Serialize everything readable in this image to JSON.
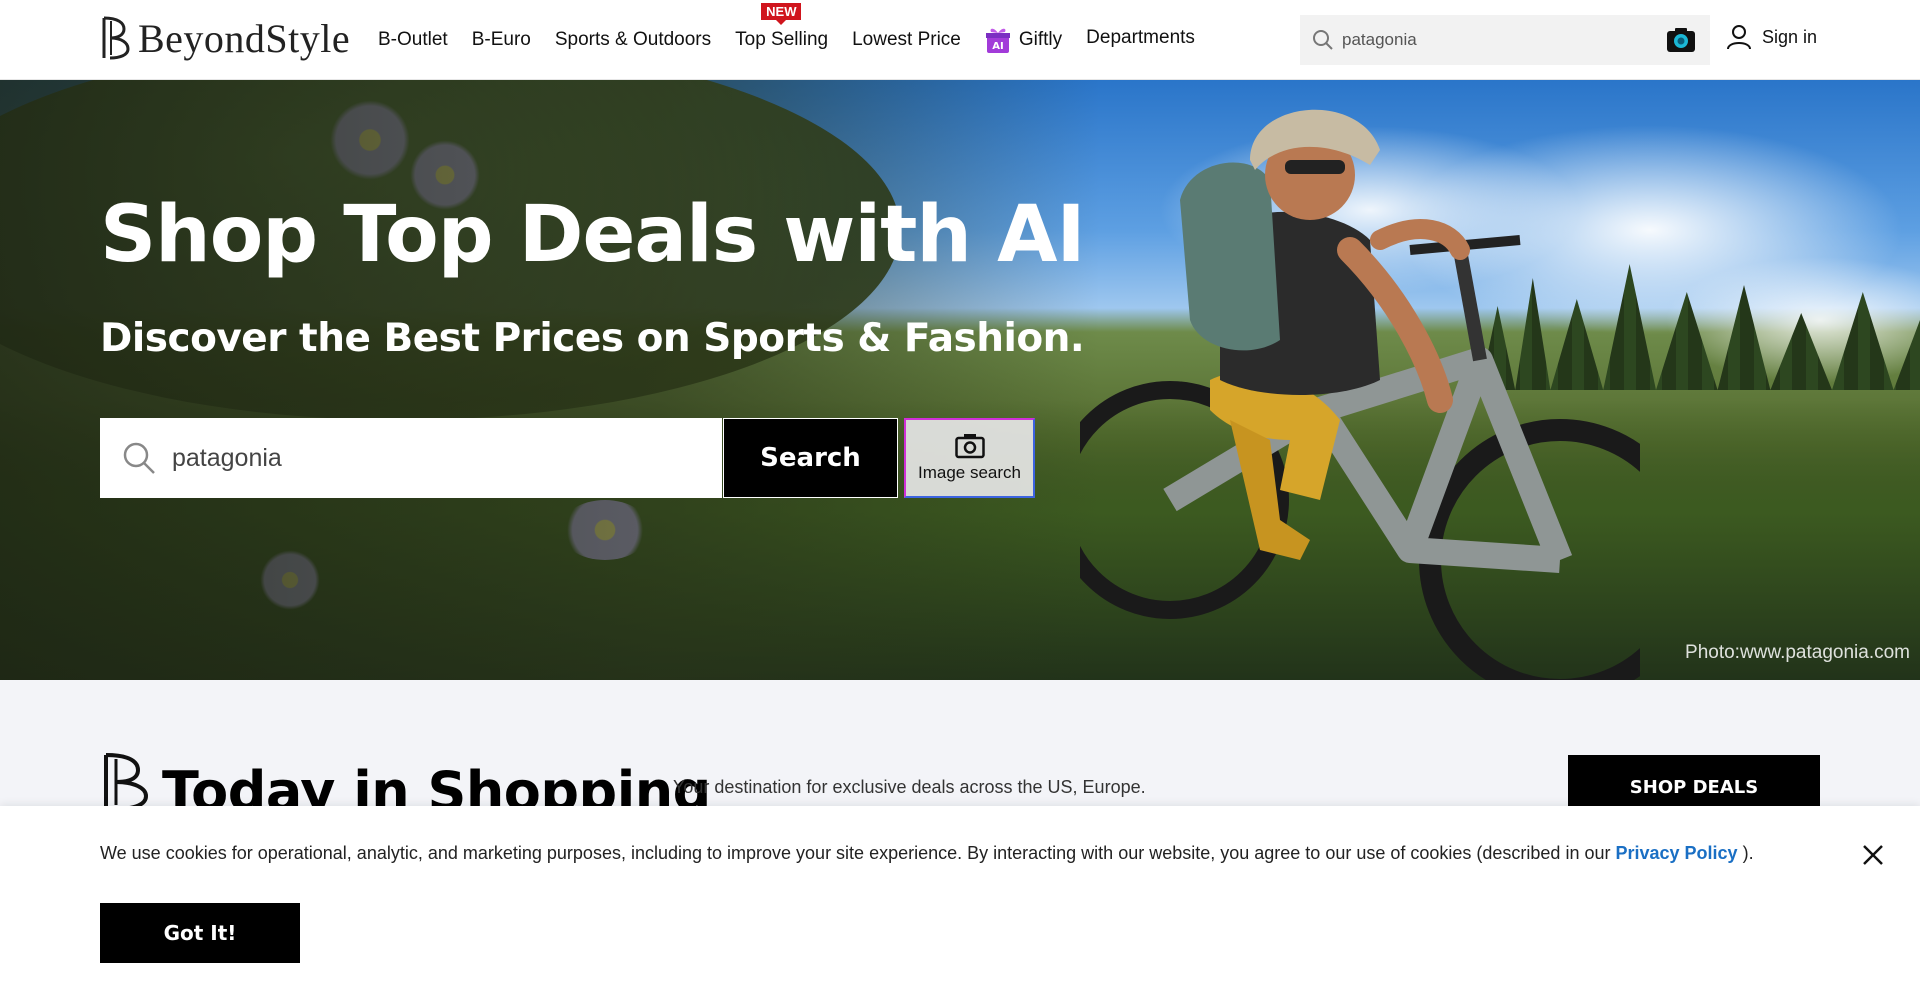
{
  "brand": {
    "name": "BeyondStyle"
  },
  "nav": {
    "items": [
      {
        "label": "B-Outlet"
      },
      {
        "label": "B-Euro"
      },
      {
        "label": "Sports & Outdoors"
      },
      {
        "label": "Top Selling",
        "badge": "NEW"
      },
      {
        "label": "Lowest Price"
      },
      {
        "label": "Giftly",
        "icon_badge": "AI"
      },
      {
        "label": "Departments"
      }
    ]
  },
  "top_search": {
    "value": "patagonia",
    "icon": "search-icon",
    "camera_icon": "camera-icon"
  },
  "account": {
    "signin_label": "Sign in",
    "icon": "user-icon"
  },
  "hero": {
    "title": "Shop Top Deals with AI",
    "subtitle": "Discover the Best Prices on Sports & Fashion.",
    "search_value": "patagonia",
    "search_button": "Search",
    "image_search_label": "Image search",
    "photo_credit": "Photo:www.patagonia.com"
  },
  "today": {
    "title": "Today in Shopping",
    "description": "Your destination for exclusive deals across the US, Europe.",
    "cta": "SHOP DEALS"
  },
  "cookie": {
    "text_before": "We use cookies for operational, analytic, and marketing purposes, including to improve your site experience. By interacting with our website, you agree to our use of cookies (described in our ",
    "link_label": "Privacy Policy",
    "text_after": " ).",
    "accept_label": "Got It!"
  },
  "colors": {
    "accent_link": "#1a6fc4",
    "badge_red": "#d0151d",
    "primary_button": "#000000"
  }
}
